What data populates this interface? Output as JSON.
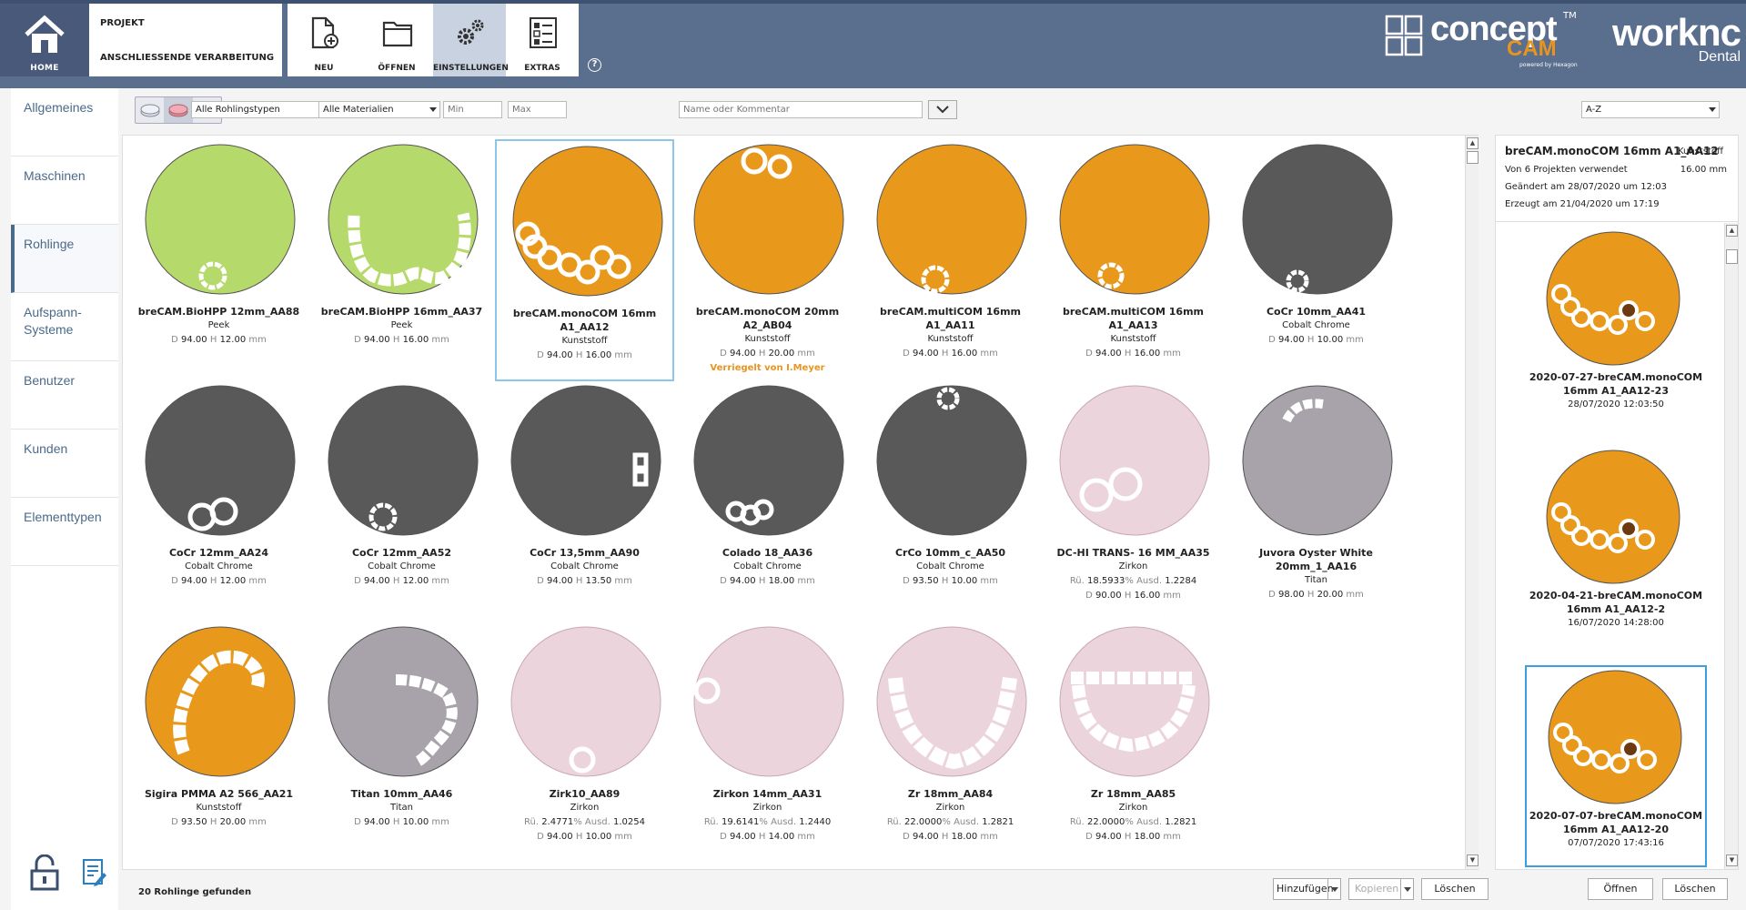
{
  "topbar": {
    "home_label": "HOME",
    "project_label": "PROJEKT",
    "followup_label": "ANSCHLIESSENDE VERARBEITUNG",
    "tools": [
      {
        "label": "NEU",
        "icon": "new-file-icon",
        "active": false
      },
      {
        "label": "ÖFFNEN",
        "icon": "folder-icon",
        "active": false
      },
      {
        "label": "EINSTELLUNGEN",
        "icon": "gears-icon",
        "active": true
      },
      {
        "label": "EXTRAS",
        "icon": "extras-icon",
        "active": false
      }
    ],
    "help_label": "?",
    "logo_concept": "concept",
    "logo_tm": "TM",
    "logo_cam": "CAM",
    "logo_powered": "powered by Hexagon",
    "logo_worknc": "worknc",
    "logo_dental": "Dental"
  },
  "sidebar": {
    "items": [
      {
        "label": "Allgemeines",
        "active": false
      },
      {
        "label": "Maschinen",
        "active": false
      },
      {
        "label": "Rohlinge",
        "active": true
      },
      {
        "label": "Aufspann-\nSysteme",
        "active": false
      },
      {
        "label": "Benutzer",
        "active": false
      },
      {
        "label": "Kunden",
        "active": false
      },
      {
        "label": "Elementtypen",
        "active": false
      }
    ]
  },
  "filters": {
    "type": "Alle Rohlingstypen",
    "material": "Alle Materialien",
    "min_placeholder": "Min",
    "max_placeholder": "Max",
    "search_placeholder": "Name oder Kommentar",
    "sort": "A-Z"
  },
  "colors": {
    "green": "#b5d96b",
    "orange": "#e8981a",
    "gray": "#595959",
    "pink": "#ecd4dc",
    "titan": "#a8a2aa",
    "accent": "#5a6e8e",
    "locked": "#e8941e"
  },
  "blanks": [
    {
      "name": "breCAM.BioHPP 12mm_AA88",
      "material": "Peek",
      "d": "94.00",
      "h": "12.00",
      "unit": "mm",
      "color": "green"
    },
    {
      "name": "breCAM.BioHPP 16mm_AA37",
      "material": "Peek",
      "d": "94.00",
      "h": "16.00",
      "unit": "mm",
      "color": "green"
    },
    {
      "name": "breCAM.monoCOM 16mm A1_AA12",
      "material": "Kunststoff",
      "d": "94.00",
      "h": "16.00",
      "unit": "mm",
      "color": "orange",
      "selected": true
    },
    {
      "name": "breCAM.monoCOM 20mm A2_AB04",
      "material": "Kunststoff",
      "d": "94.00",
      "h": "20.00",
      "unit": "mm",
      "color": "orange",
      "locked": "Verriegelt von I.Meyer"
    },
    {
      "name": "breCAM.multiCOM 16mm A1_AA11",
      "material": "Kunststoff",
      "d": "94.00",
      "h": "16.00",
      "unit": "mm",
      "color": "orange"
    },
    {
      "name": "breCAM.multiCOM 16mm A1_AA13",
      "material": "Kunststoff",
      "d": "94.00",
      "h": "16.00",
      "unit": "mm",
      "color": "orange"
    },
    {
      "name": "CoCr 10mm_AA41",
      "material": "Cobalt Chrome",
      "d": "94.00",
      "h": "10.00",
      "unit": "mm",
      "color": "gray"
    },
    {
      "name": "CoCr 12mm_AA24",
      "material": "Cobalt Chrome",
      "d": "94.00",
      "h": "12.00",
      "unit": "mm",
      "color": "gray"
    },
    {
      "name": "CoCr 12mm_AA52",
      "material": "Cobalt Chrome",
      "d": "94.00",
      "h": "12.00",
      "unit": "mm",
      "color": "gray"
    },
    {
      "name": "CoCr 13,5mm_AA90",
      "material": "Cobalt Chrome",
      "d": "94.00",
      "h": "13.50",
      "unit": "mm",
      "color": "gray"
    },
    {
      "name": "Colado 18_AA36",
      "material": "Cobalt Chrome",
      "d": "94.00",
      "h": "18.00",
      "unit": "mm",
      "color": "gray"
    },
    {
      "name": "CrCo 10mm_c_AA50",
      "material": "Cobalt Chrome",
      "d": "93.50",
      "h": "10.00",
      "unit": "mm",
      "color": "gray"
    },
    {
      "name": "DC-HI TRANS- 16 MM_AA35",
      "material": "Zirkon",
      "ru": "18.5933",
      "ausd": "1.2284",
      "d": "90.00",
      "h": "16.00",
      "unit": "mm",
      "color": "pink"
    },
    {
      "name": "Juvora Oyster White 20mm_1_AA16",
      "material": "Titan",
      "d": "98.00",
      "h": "20.00",
      "unit": "mm",
      "color": "titan"
    },
    {
      "name": "Sigira PMMA A2 566_AA21",
      "material": "Kunststoff",
      "d": "93.50",
      "h": "20.00",
      "unit": "mm",
      "color": "orange"
    },
    {
      "name": "Titan 10mm_AA46",
      "material": "Titan",
      "d": "94.00",
      "h": "10.00",
      "unit": "mm",
      "color": "titan"
    },
    {
      "name": "Zirk10_AA89",
      "material": "Zirkon",
      "ru": "2.4771",
      "ausd": "1.0254",
      "d": "94.00",
      "h": "10.00",
      "unit": "mm",
      "color": "pink"
    },
    {
      "name": "Zirkon 14mm_AA31",
      "material": "Zirkon",
      "ru": "19.6141",
      "ausd": "1.2440",
      "d": "94.00",
      "h": "14.00",
      "unit": "mm",
      "color": "pink"
    },
    {
      "name": "Zr 18mm_AA84",
      "material": "Zirkon",
      "ru": "22.0000",
      "ausd": "1.2821",
      "d": "94.00",
      "h": "18.00",
      "unit": "mm",
      "color": "pink"
    },
    {
      "name": "Zr 18mm_AA85",
      "material": "Zirkon",
      "ru": "22.0000",
      "ausd": "1.2821",
      "d": "94.00",
      "h": "18.00",
      "unit": "mm",
      "color": "pink"
    }
  ],
  "labels": {
    "d": "D",
    "h": "H",
    "ru": "Rü.",
    "ausd": "Ausd.",
    "pct": "%"
  },
  "footer": {
    "count": "20 Rohlinge gefunden",
    "add": "Hinzufügen",
    "copy": "Kopieren",
    "delete": "Löschen"
  },
  "details": {
    "title": "breCAM.monoCOM 16mm A1_AA12",
    "material": "Kunststoff",
    "height": "16.00 mm",
    "used": "Von 6 Projekten verwendet",
    "changed": "Geändert am 28/07/2020 um 12:03",
    "created": "Erzeugt am 21/04/2020 um 17:19",
    "projects": [
      {
        "name": "2020-07-27-breCAM.monoCOM 16mm A1_AA12-23",
        "date": "28/07/2020 12:03:50",
        "selected": false
      },
      {
        "name": "2020-04-21-breCAM.monoCOM 16mm A1_AA12-2",
        "date": "16/07/2020 14:28:00",
        "selected": false
      },
      {
        "name": "2020-07-07-breCAM.monoCOM 16mm A1_AA12-20",
        "date": "07/07/2020 17:43:16",
        "selected": true
      }
    ],
    "open": "Öffnen",
    "delete": "Löschen"
  }
}
